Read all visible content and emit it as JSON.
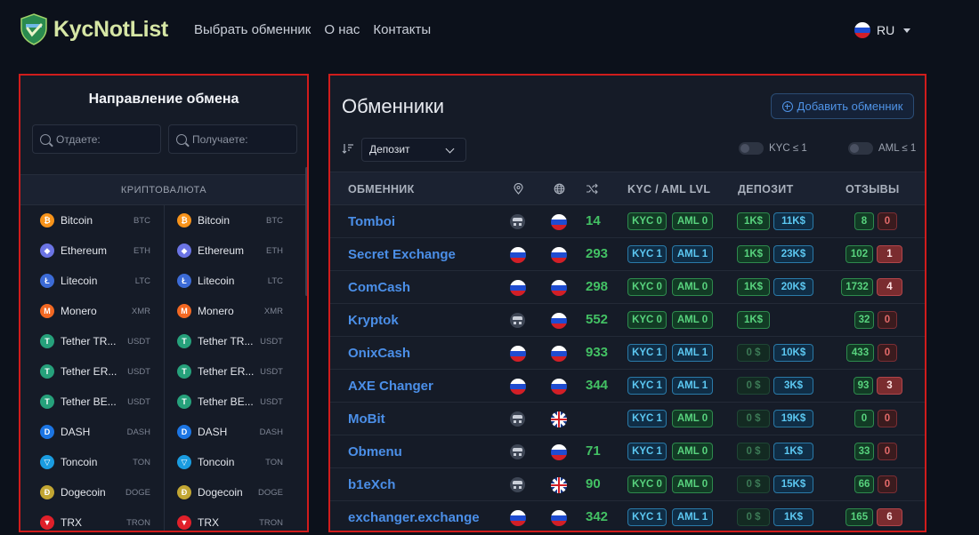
{
  "header": {
    "logo_text": "KycNotList",
    "nav": [
      "Выбрать обменник",
      "О нас",
      "Контакты"
    ],
    "language": "RU"
  },
  "left_panel": {
    "title": "Направление обмена",
    "give_placeholder": "Отдаете:",
    "get_placeholder": "Получаете:",
    "category": "КРИПТОВАЛЮТА",
    "coins": [
      {
        "name": "Bitcoin",
        "ticker": "BTC",
        "icon": "bitcoin-icon",
        "color": "#f7931a",
        "glyph": "₿"
      },
      {
        "name": "Ethereum",
        "ticker": "ETH",
        "icon": "ethereum-icon",
        "color": "#6b74e4",
        "glyph": "◆"
      },
      {
        "name": "Litecoin",
        "ticker": "LTC",
        "icon": "litecoin-icon",
        "color": "#3c6bd6",
        "glyph": "Ł"
      },
      {
        "name": "Monero",
        "ticker": "XMR",
        "icon": "monero-icon",
        "color": "#f26822",
        "glyph": "M"
      },
      {
        "name": "Tether TR...",
        "ticker": "USDT",
        "icon": "tether-icon",
        "color": "#26a17b",
        "glyph": "T"
      },
      {
        "name": "Tether ER...",
        "ticker": "USDT",
        "icon": "tether-icon",
        "color": "#26a17b",
        "glyph": "T"
      },
      {
        "name": "Tether BE...",
        "ticker": "USDT",
        "icon": "tether-icon",
        "color": "#26a17b",
        "glyph": "T"
      },
      {
        "name": "DASH",
        "ticker": "DASH",
        "icon": "dash-icon",
        "color": "#1c75e3",
        "glyph": "D"
      },
      {
        "name": "Toncoin",
        "ticker": "TON",
        "icon": "toncoin-icon",
        "color": "#1a9ce0",
        "glyph": "▽"
      },
      {
        "name": "Dogecoin",
        "ticker": "DOGE",
        "icon": "dogecoin-icon",
        "color": "#c2a633",
        "glyph": "Ð"
      },
      {
        "name": "TRX",
        "ticker": "TRON",
        "icon": "tron-icon",
        "color": "#e0202a",
        "glyph": "▼"
      }
    ]
  },
  "right_panel": {
    "title": "Обменники",
    "add_button": "Добавить обменник",
    "sort_selected": "Депозит",
    "toggle_kyc": "KYC ≤ 1",
    "toggle_aml": "AML ≤ 1",
    "columns": {
      "exchanger": "ОБМЕННИК",
      "kyc_aml": "KYC / AML LVL",
      "deposit": "ДЕПОЗИТ",
      "reviews": "ОТЗЫВЫ"
    },
    "rows": [
      {
        "name": "Tomboi",
        "loc": "spy",
        "site": "ru",
        "rating": "14",
        "kyc": "KYC 0",
        "kyc_c": "green",
        "aml": "AML 0",
        "aml_c": "green",
        "dep1": "1K$",
        "dep1_c": "green",
        "dep2": "11K$",
        "dep2_c": "blue",
        "rev_pos": "8",
        "rev_neg": "0",
        "neg_style": "red"
      },
      {
        "name": "Secret Exchange",
        "loc": "ru",
        "site": "ru",
        "rating": "293",
        "kyc": "KYC 1",
        "kyc_c": "blue",
        "aml": "AML 1",
        "aml_c": "blue",
        "dep1": "1K$",
        "dep1_c": "green",
        "dep2": "23K$",
        "dep2_c": "blue",
        "rev_pos": "102",
        "rev_neg": "1",
        "neg_style": "redfill"
      },
      {
        "name": "ComCash",
        "loc": "ru",
        "site": "ru",
        "rating": "298",
        "kyc": "KYC 0",
        "kyc_c": "green",
        "aml": "AML 0",
        "aml_c": "green",
        "dep1": "1K$",
        "dep1_c": "green",
        "dep2": "20K$",
        "dep2_c": "blue",
        "rev_pos": "1732",
        "rev_neg": "4",
        "neg_style": "redfill"
      },
      {
        "name": "Kryptok",
        "loc": "spy",
        "site": "ru",
        "rating": "552",
        "kyc": "KYC 0",
        "kyc_c": "green",
        "aml": "AML 0",
        "aml_c": "green",
        "dep1": "1K$",
        "dep1_c": "green",
        "dep2": "",
        "dep2_c": "blue",
        "rev_pos": "32",
        "rev_neg": "0",
        "neg_style": "red"
      },
      {
        "name": "OnixCash",
        "loc": "ru",
        "site": "ru",
        "rating": "933",
        "kyc": "KYC 1",
        "kyc_c": "blue",
        "aml": "AML 1",
        "aml_c": "blue",
        "dep1": "0 $",
        "dep1_c": "dim",
        "dep2": "10K$",
        "dep2_c": "blue",
        "rev_pos": "433",
        "rev_neg": "0",
        "neg_style": "red"
      },
      {
        "name": "AXE Changer",
        "loc": "ru",
        "site": "ru",
        "rating": "344",
        "kyc": "KYC 1",
        "kyc_c": "blue",
        "aml": "AML 1",
        "aml_c": "blue",
        "dep1": "0 $",
        "dep1_c": "dim",
        "dep2": "3K$",
        "dep2_c": "blue",
        "rev_pos": "93",
        "rev_neg": "3",
        "neg_style": "redfill"
      },
      {
        "name": "MoBit",
        "loc": "spy",
        "site": "uk",
        "rating": "",
        "kyc": "KYC 1",
        "kyc_c": "blue",
        "aml": "AML 0",
        "aml_c": "green",
        "dep1": "0 $",
        "dep1_c": "dim",
        "dep2": "19K$",
        "dep2_c": "blue",
        "rev_pos": "0",
        "rev_neg": "0",
        "neg_style": "red"
      },
      {
        "name": "Obmenu",
        "loc": "spy",
        "site": "ru",
        "rating": "71",
        "kyc": "KYC 1",
        "kyc_c": "blue",
        "aml": "AML 0",
        "aml_c": "green",
        "dep1": "0 $",
        "dep1_c": "dim",
        "dep2": "1K$",
        "dep2_c": "blue",
        "rev_pos": "33",
        "rev_neg": "0",
        "neg_style": "red"
      },
      {
        "name": "b1eXch",
        "loc": "spy",
        "site": "uk",
        "rating": "90",
        "kyc": "KYC 0",
        "kyc_c": "green",
        "aml": "AML 0",
        "aml_c": "green",
        "dep1": "0 $",
        "dep1_c": "dim",
        "dep2": "15K$",
        "dep2_c": "blue",
        "rev_pos": "66",
        "rev_neg": "0",
        "neg_style": "red"
      },
      {
        "name": "exchanger.exchange",
        "loc": "ru",
        "site": "ru",
        "rating": "342",
        "kyc": "KYC 1",
        "kyc_c": "blue",
        "aml": "AML 1",
        "aml_c": "blue",
        "dep1": "0 $",
        "dep1_c": "dim",
        "dep2": "1K$",
        "dep2_c": "blue",
        "rev_pos": "165",
        "rev_neg": "6",
        "neg_style": "redfill"
      }
    ]
  }
}
